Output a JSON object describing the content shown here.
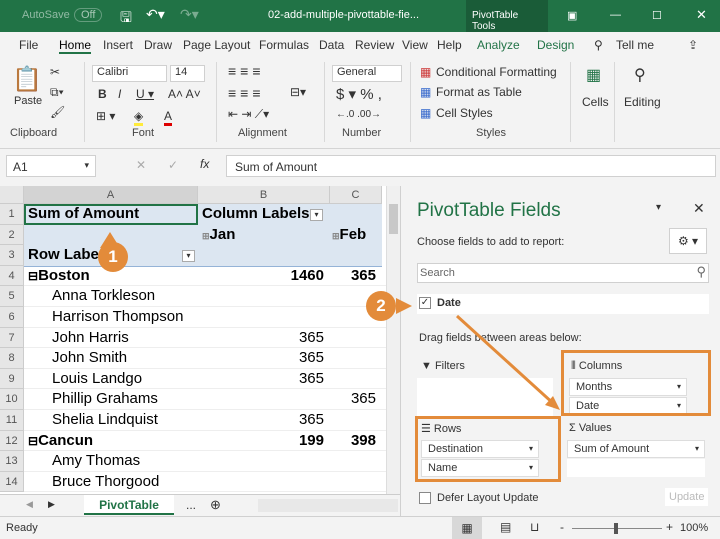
{
  "titlebar": {
    "autosave": "AutoSave",
    "autosave_state": "Off",
    "filename": "02-add-multiple-pivottable-fie...",
    "context": "PivotTable Tools"
  },
  "tabs": [
    "File",
    "Home",
    "Insert",
    "Draw",
    "Page Layout",
    "Formulas",
    "Data",
    "Review",
    "View",
    "Help",
    "Analyze",
    "Design",
    "Tell me"
  ],
  "ribbon": {
    "paste": "Paste",
    "font": "Calibri",
    "size": "14",
    "number_format": "General",
    "cond_fmt": "Conditional Formatting",
    "format_table": "Format as Table",
    "cell_styles": "Cell Styles",
    "cells": "Cells",
    "editing": "Editing",
    "groups": [
      "Clipboard",
      "Font",
      "Alignment",
      "Number",
      "Styles"
    ]
  },
  "formula": {
    "namebox": "A1",
    "content": "Sum of Amount"
  },
  "grid": {
    "columns": [
      "A",
      "B",
      "C"
    ],
    "rows": [
      {
        "n": "1",
        "a": "Sum of Amount",
        "b": "Column Labels",
        "c": ""
      },
      {
        "n": "2",
        "a": "",
        "b": "Jan",
        "c": "Feb"
      },
      {
        "n": "3",
        "a": "Row Labe",
        "b": "",
        "c": ""
      },
      {
        "n": "4",
        "a": "Boston",
        "b": "1460",
        "c": "365"
      },
      {
        "n": "5",
        "a": "Anna Torkleson",
        "b": "",
        "c": ""
      },
      {
        "n": "6",
        "a": "Harrison Thompson",
        "b": "",
        "c": ""
      },
      {
        "n": "7",
        "a": "John Harris",
        "b": "365",
        "c": ""
      },
      {
        "n": "8",
        "a": "John Smith",
        "b": "365",
        "c": ""
      },
      {
        "n": "9",
        "a": "Louis Landgo",
        "b": "365",
        "c": ""
      },
      {
        "n": "10",
        "a": "Phillip Grahams",
        "b": "",
        "c": "365"
      },
      {
        "n": "11",
        "a": "Shelia Lindquist",
        "b": "365",
        "c": ""
      },
      {
        "n": "12",
        "a": "Cancun",
        "b": "199",
        "c": "398"
      },
      {
        "n": "13",
        "a": "Amy Thomas",
        "b": "",
        "c": ""
      },
      {
        "n": "14",
        "a": "Bruce Thorgood",
        "b": "",
        "c": ""
      }
    ]
  },
  "sheet": {
    "tab": "PivotTable",
    "more": "..."
  },
  "status": {
    "ready": "Ready",
    "zoom": "100%"
  },
  "pane": {
    "title": "PivotTable Fields",
    "choose": "Choose fields to add to report:",
    "search_placeholder": "Search",
    "field": "Date",
    "drag": "Drag fields between areas below:",
    "filters": "Filters",
    "columns": "Columns",
    "rows": "Rows",
    "values": "Values",
    "columns_items": [
      "Months",
      "Date"
    ],
    "rows_items": [
      "Destination",
      "Name"
    ],
    "values_items": [
      "Sum of Amount"
    ],
    "defer": "Defer Layout Update",
    "update": "Update"
  },
  "callouts": [
    "1",
    "2"
  ],
  "colors": {
    "excel_green": "#217346",
    "callout": "#e38b3a",
    "pivot_header": "#dce6f1"
  }
}
